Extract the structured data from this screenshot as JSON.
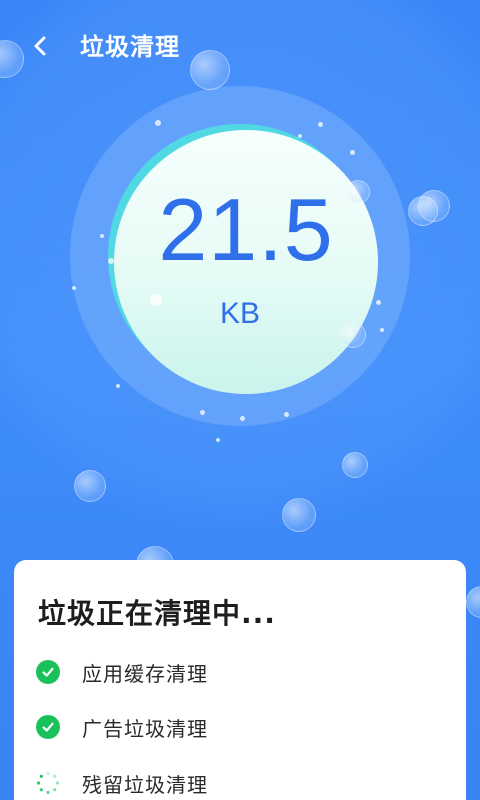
{
  "header": {
    "title": "垃圾清理",
    "back_icon": "chevron-left-icon"
  },
  "meter": {
    "amount": "21.5",
    "unit": "KB",
    "colors": {
      "background": "#3a86f8",
      "ring": "#50d9e3",
      "text": "#2f6fe9"
    }
  },
  "status_card": {
    "title": "垃圾正在清理中...",
    "tasks": [
      {
        "label": "应用缓存清理",
        "state": "done",
        "icon": "check-circle-icon"
      },
      {
        "label": "广告垃圾清理",
        "state": "done",
        "icon": "check-circle-icon"
      },
      {
        "label": "残留垃圾清理",
        "state": "in-progress",
        "icon": "spinner-icon"
      }
    ],
    "colors": {
      "check": "#19c15a"
    }
  }
}
